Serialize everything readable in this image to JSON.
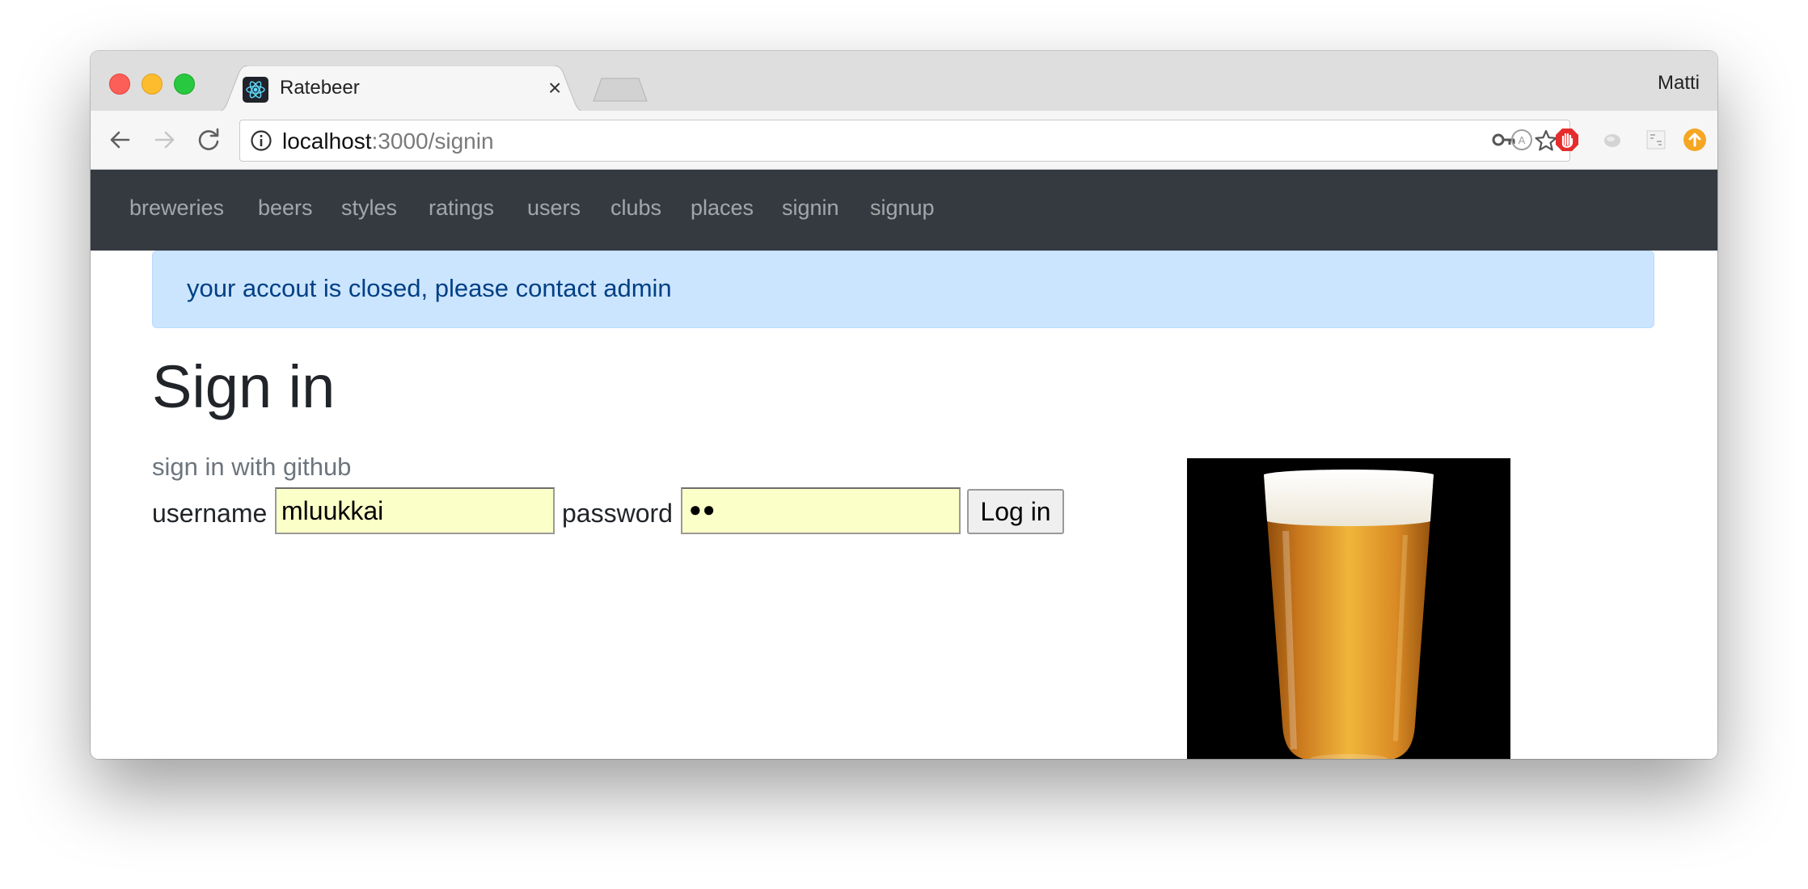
{
  "browser": {
    "tab_title": "Ratebeer",
    "tab_close_glyph": "×",
    "profile_name": "Matti",
    "url_host": "localhost",
    "url_path": ":3000/signin"
  },
  "icons": {
    "back": "back-arrow-icon",
    "forward": "forward-arrow-icon",
    "reload": "reload-icon",
    "info": "info-icon",
    "key": "key-icon",
    "star": "bookmark-star-icon",
    "favicon": "react-logo-icon"
  },
  "colors": {
    "navbar_bg": "#343a40",
    "nav_link": "rgba(255,255,255,0.55)",
    "alert_bg": "#cce5ff",
    "alert_text": "#004085",
    "autofill_bg": "#fbffc8"
  },
  "navbar": {
    "links": [
      "breweries",
      "beers",
      "styles",
      "ratings",
      "users",
      "clubs",
      "places",
      "signin",
      "signup"
    ]
  },
  "alert": {
    "message": "your accout is closed, please contact admin"
  },
  "signin": {
    "title": "Sign in",
    "github_link": "sign in with github",
    "username_label": "username",
    "username_value": "mluukkai",
    "password_label": "password",
    "password_mask": "●●",
    "login_button": "Log in"
  }
}
